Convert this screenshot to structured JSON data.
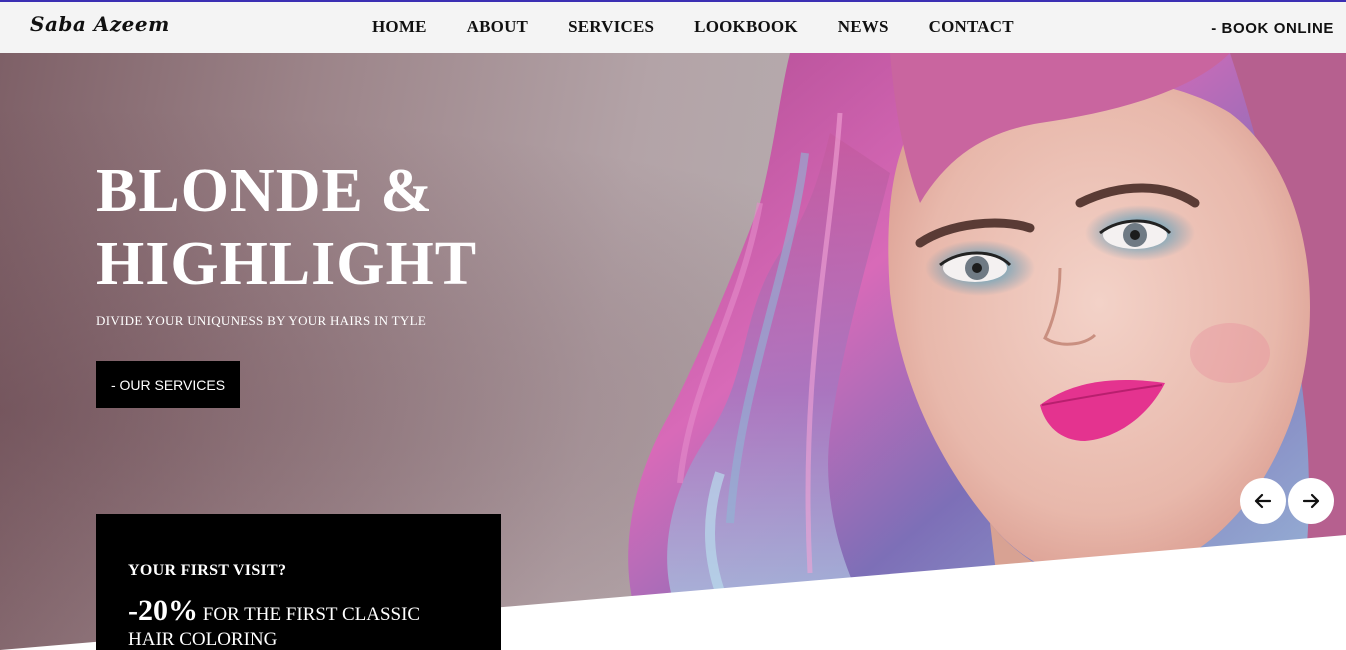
{
  "header": {
    "logo": "Saba Azeem",
    "nav": [
      "HOME",
      "ABOUT",
      "SERVICES",
      "LOOKBOOK",
      "NEWS",
      "CONTACT"
    ],
    "book_online": "- BOOK ONLINE"
  },
  "hero": {
    "headline_line1": "BLONDE &",
    "headline_line2": "HIGHLIGHT",
    "subline": "DIVIDE YOUR UNIQUNESS BY YOUR HAIRS IN TYLE",
    "button": "- OUR SERVICES",
    "prev_icon": "arrow-left-icon",
    "next_icon": "arrow-right-icon"
  },
  "promo": {
    "title": "YOUR FIRST VISIT?",
    "percent": "-20%",
    "text": "FOR THE FIRST CLASSIC HAIR COLORING"
  },
  "colors": {
    "accent_line": "#3b2fb3",
    "lip": "#e4338f",
    "hair_pink": "#c04a96",
    "hair_blue": "#8fb6d6"
  }
}
